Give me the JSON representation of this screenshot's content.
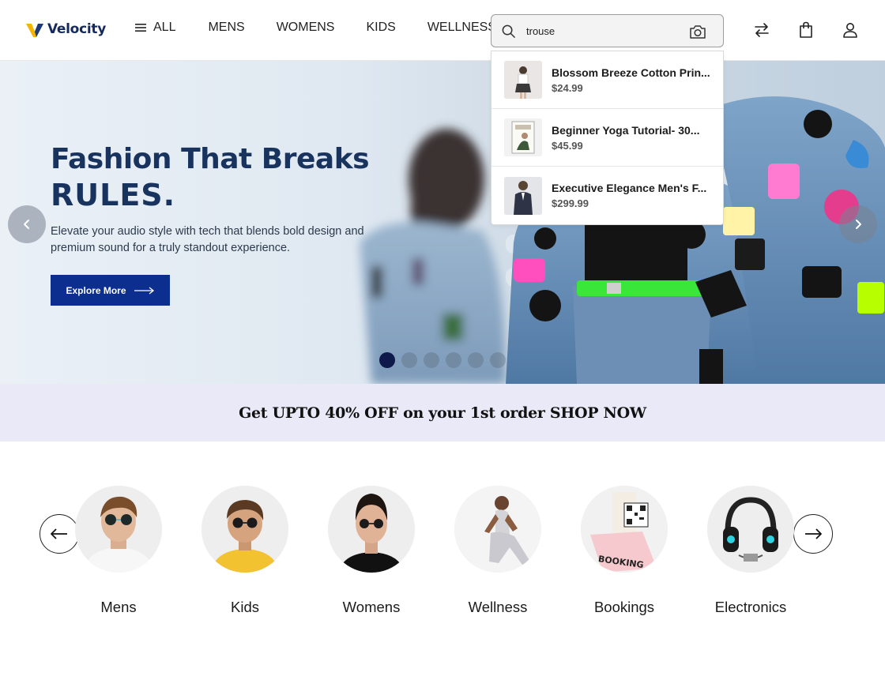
{
  "header": {
    "brand": "Velocity",
    "nav": [
      {
        "label": "ALL"
      },
      {
        "label": "MENS"
      },
      {
        "label": "WOMENS"
      },
      {
        "label": "KIDS"
      },
      {
        "label": "WELLNESS"
      }
    ],
    "search": {
      "value": "trouse"
    },
    "icons": [
      "compare-icon",
      "shopping-bag-icon",
      "user-account-icon"
    ]
  },
  "search_results": [
    {
      "name": "Blossom Breeze Cotton Prin...",
      "price": "$24.99"
    },
    {
      "name": "Beginner Yoga Tutorial- 30...",
      "price": "$45.99"
    },
    {
      "name": "Executive Elegance Men's F...",
      "price": "$299.99"
    }
  ],
  "hero": {
    "title_line1": "Fashion That Breaks",
    "title_line2": "RULES.",
    "subtitle": "Elevate your audio style with tech that blends bold design and premium sound for a truly standout experience.",
    "cta": "Explore More",
    "slide_count": 6,
    "active_slide": 1
  },
  "promo": {
    "text": "Get UPTO 40% OFF on your 1st order SHOP NOW"
  },
  "categories": [
    {
      "label": "Mens"
    },
    {
      "label": "Kids"
    },
    {
      "label": "Womens"
    },
    {
      "label": "Wellness"
    },
    {
      "label": "Bookings"
    },
    {
      "label": "Electronics"
    }
  ],
  "colors": {
    "brand_navy": "#19335f",
    "cta_blue": "#0c2e8f",
    "promo_bg": "#eae9f8",
    "logo_yellow": "#f5b400"
  }
}
